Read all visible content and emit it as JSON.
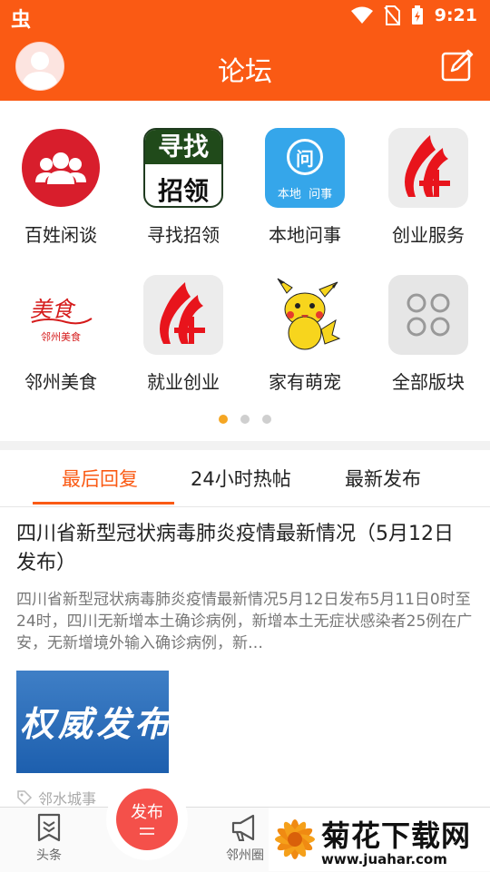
{
  "status": {
    "time": "9:21",
    "logo_char": "虫"
  },
  "header": {
    "title": "论坛"
  },
  "grid": [
    {
      "label": "百姓闲谈",
      "icon": "people-icon"
    },
    {
      "label": "寻找招领",
      "icon": "lost-found-icon",
      "icon_text": [
        "寻找",
        "招领"
      ]
    },
    {
      "label": "本地问事",
      "icon": "local-question-icon",
      "icon_text": [
        "问",
        "本地",
        "问事"
      ]
    },
    {
      "label": "创业服务",
      "icon": "startup-logo-icon"
    },
    {
      "label": "邻州美食",
      "icon": "food-logo-icon",
      "icon_text": [
        "美食",
        "邻州美食"
      ]
    },
    {
      "label": "就业创业",
      "icon": "employment-logo-icon"
    },
    {
      "label": "家有萌宠",
      "icon": "pikachu-icon"
    },
    {
      "label": "全部版块",
      "icon": "all-sections-icon"
    }
  ],
  "pager": {
    "count": 3,
    "active": 0
  },
  "tabs": [
    "最后回复",
    "24小时热帖",
    "最新发布"
  ],
  "post": {
    "title": "四川省新型冠状病毒肺炎疫情最新情况（5月12日发布）",
    "excerpt": "四川省新型冠状病毒肺炎疫情最新情况5月12日发布5月11日0时至24时，四川无新增本土确诊病例，新增本土无症状感染者25例在广安，无新增境外输入确诊病例，新…",
    "thumb_text": "权威发布",
    "tag": "邻水城事"
  },
  "nav": {
    "headlines": "头条",
    "publish": "发布",
    "circle": "邻州圈"
  },
  "watermark": {
    "title": "菊花下载网",
    "url": "www.juahar.com"
  },
  "colors": {
    "brand": "#fa5a14",
    "fab": "#f4504a",
    "active_dot": "#f5a623"
  }
}
